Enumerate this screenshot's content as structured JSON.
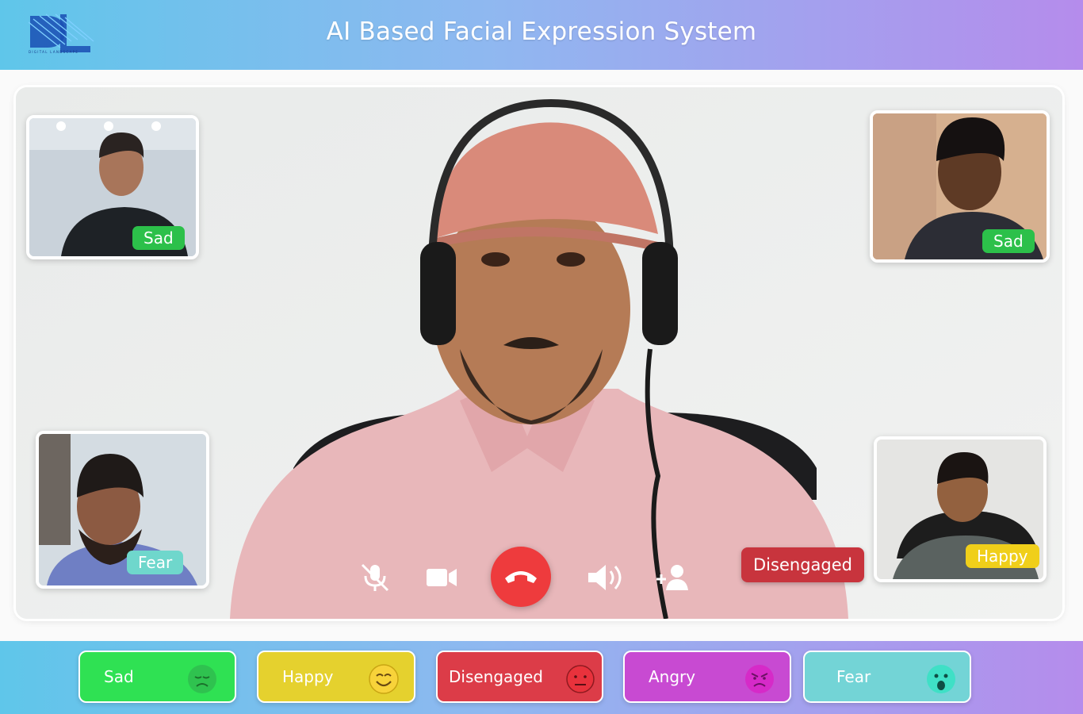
{
  "header": {
    "title": "AI Based Facial Expression System",
    "logo_text": "DIGITAL LANDSCAPE"
  },
  "main_video": {
    "participant_expression": "Disengaged",
    "badge_color": "#c8343d"
  },
  "participants": [
    {
      "expression": "Sad",
      "badge_color": "#2cc04a"
    },
    {
      "expression": "Sad",
      "badge_color": "#2cc04a"
    },
    {
      "expression": "Fear",
      "badge_color": "#6fd7cc"
    },
    {
      "expression": "Happy",
      "badge_color": "#f0cf1a"
    }
  ],
  "controls": {
    "mic": "mic-off-icon",
    "camera": "video-camera-icon",
    "end_call": "phone-hangup-icon",
    "volume": "volume-icon",
    "add_participant": "add-person-icon"
  },
  "legend": [
    {
      "label": "Sad",
      "color": "#2fe153",
      "icon": "sad-face-icon"
    },
    {
      "label": "Happy",
      "color": "#e5d12e",
      "icon": "smiling-face-icon"
    },
    {
      "label": "Disengaged",
      "color": "#dc3c48",
      "icon": "neutral-face-icon"
    },
    {
      "label": "Angry",
      "color": "#c84ad2",
      "icon": "angry-face-icon"
    },
    {
      "label": "Fear",
      "color": "#73d4d6",
      "icon": "fear-face-icon"
    }
  ]
}
